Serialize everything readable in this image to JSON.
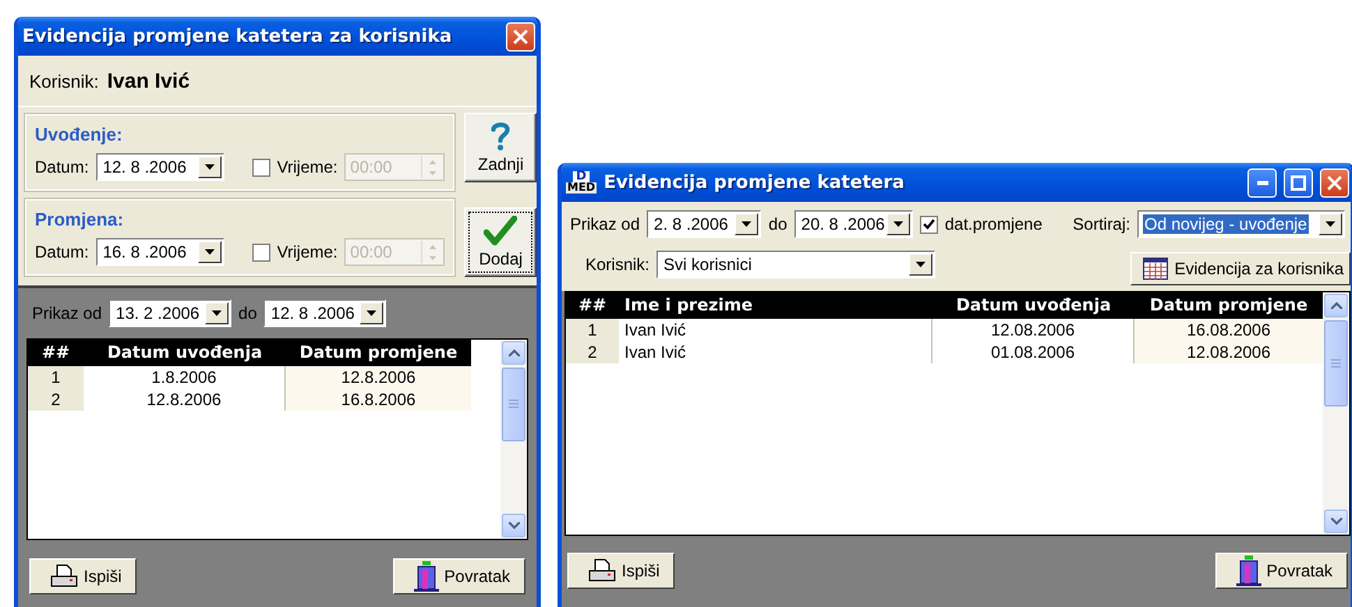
{
  "dialog": {
    "title": "Evidencija promjene katetera za korisnika",
    "user_label": "Korisnik:",
    "user_name": "Ivan Ivić",
    "groups": [
      {
        "title": "Uvođenje:",
        "date_label": "Datum:",
        "date": "12. 8 .2006",
        "time_checked": false,
        "time_label": "Vrijeme:",
        "time": "00:00",
        "time_disabled": true
      },
      {
        "title": "Promjena:",
        "date_label": "Datum:",
        "date": "16. 8 .2006",
        "time_checked": false,
        "time_label": "Vrijeme:",
        "time": "00:00",
        "time_disabled": true
      }
    ],
    "side_buttons": [
      {
        "kind": "help",
        "label": "Zadnji",
        "focused": false
      },
      {
        "kind": "check",
        "label": "Dodaj",
        "focused": true
      }
    ],
    "filter": {
      "from_label": "Prikaz od",
      "from": "13. 2 .2006",
      "to_label": "do",
      "to": "12. 8 .2006"
    },
    "table": {
      "columns": [
        "##",
        "Datum uvođenja",
        "Datum promjene"
      ],
      "rows": [
        [
          "1",
          "1.8.2006",
          "12.8.2006"
        ],
        [
          "2",
          "12.8.2006",
          "16.8.2006"
        ]
      ]
    },
    "footer": [
      {
        "kind": "print",
        "label": "Ispiši"
      },
      {
        "kind": "exit",
        "label": "Povratak"
      }
    ]
  },
  "main_window": {
    "logo_top": "D",
    "logo_bottom": "MED",
    "title": "Evidencija promjene katetera",
    "filter": {
      "from_label": "Prikaz od",
      "from": "2. 8 .2006",
      "to_label": "do",
      "to": "20. 8 .2006",
      "change_checked": true,
      "change_label": "dat.promjene",
      "sort_label": "Sortiraj:",
      "sort": "Od novijeg - uvođenje",
      "sort_focused": true,
      "user_label": "Korisnik:",
      "user": "Svi korisnici"
    },
    "user_button": "Evidencija za korisnika",
    "table": {
      "columns": [
        "##",
        "Ime i prezime",
        "Datum uvođenja",
        "Datum promjene"
      ],
      "rows": [
        [
          "1",
          "Ivan Ivić",
          "12.08.2006",
          "16.08.2006"
        ],
        [
          "2",
          "Ivan Ivić",
          "01.08.2006",
          "12.08.2006"
        ]
      ]
    },
    "footer": [
      {
        "kind": "print",
        "label": "Ispiši"
      },
      {
        "kind": "exit",
        "label": "Povratak"
      }
    ]
  }
}
